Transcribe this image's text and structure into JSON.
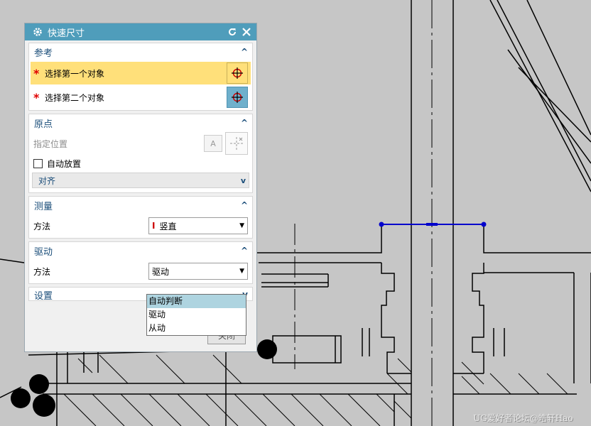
{
  "dialog": {
    "title": "快速尺寸",
    "icons": {
      "gear": "gear-icon",
      "reset": "reset-icon",
      "close": "close-icon"
    },
    "sections": {
      "reference": {
        "header": "参考",
        "first_object": "选择第一个对象",
        "second_object": "选择第二个对象"
      },
      "origin": {
        "header": "原点",
        "specify_location": "指定位置",
        "auto_place": "自动放置",
        "auto_place_checked": false,
        "align": "对齐"
      },
      "measure": {
        "header": "测量",
        "method_label": "方法",
        "method_value": "竖直"
      },
      "driving": {
        "header": "驱动",
        "method_label": "方法",
        "method_value": "驱动",
        "options": [
          "自动判断",
          "驱动",
          "从动"
        ],
        "highlighted_option": "自动判断"
      },
      "settings": {
        "header": "设置"
      }
    },
    "close_button": "关闭"
  },
  "watermark": "UG爱好者论坛@皓轩Hao",
  "colors": {
    "titlebar": "#4f9dbb",
    "selected_row": "#ffe07a",
    "dimension_line": "#0000cc",
    "required_star": "#e00000"
  }
}
